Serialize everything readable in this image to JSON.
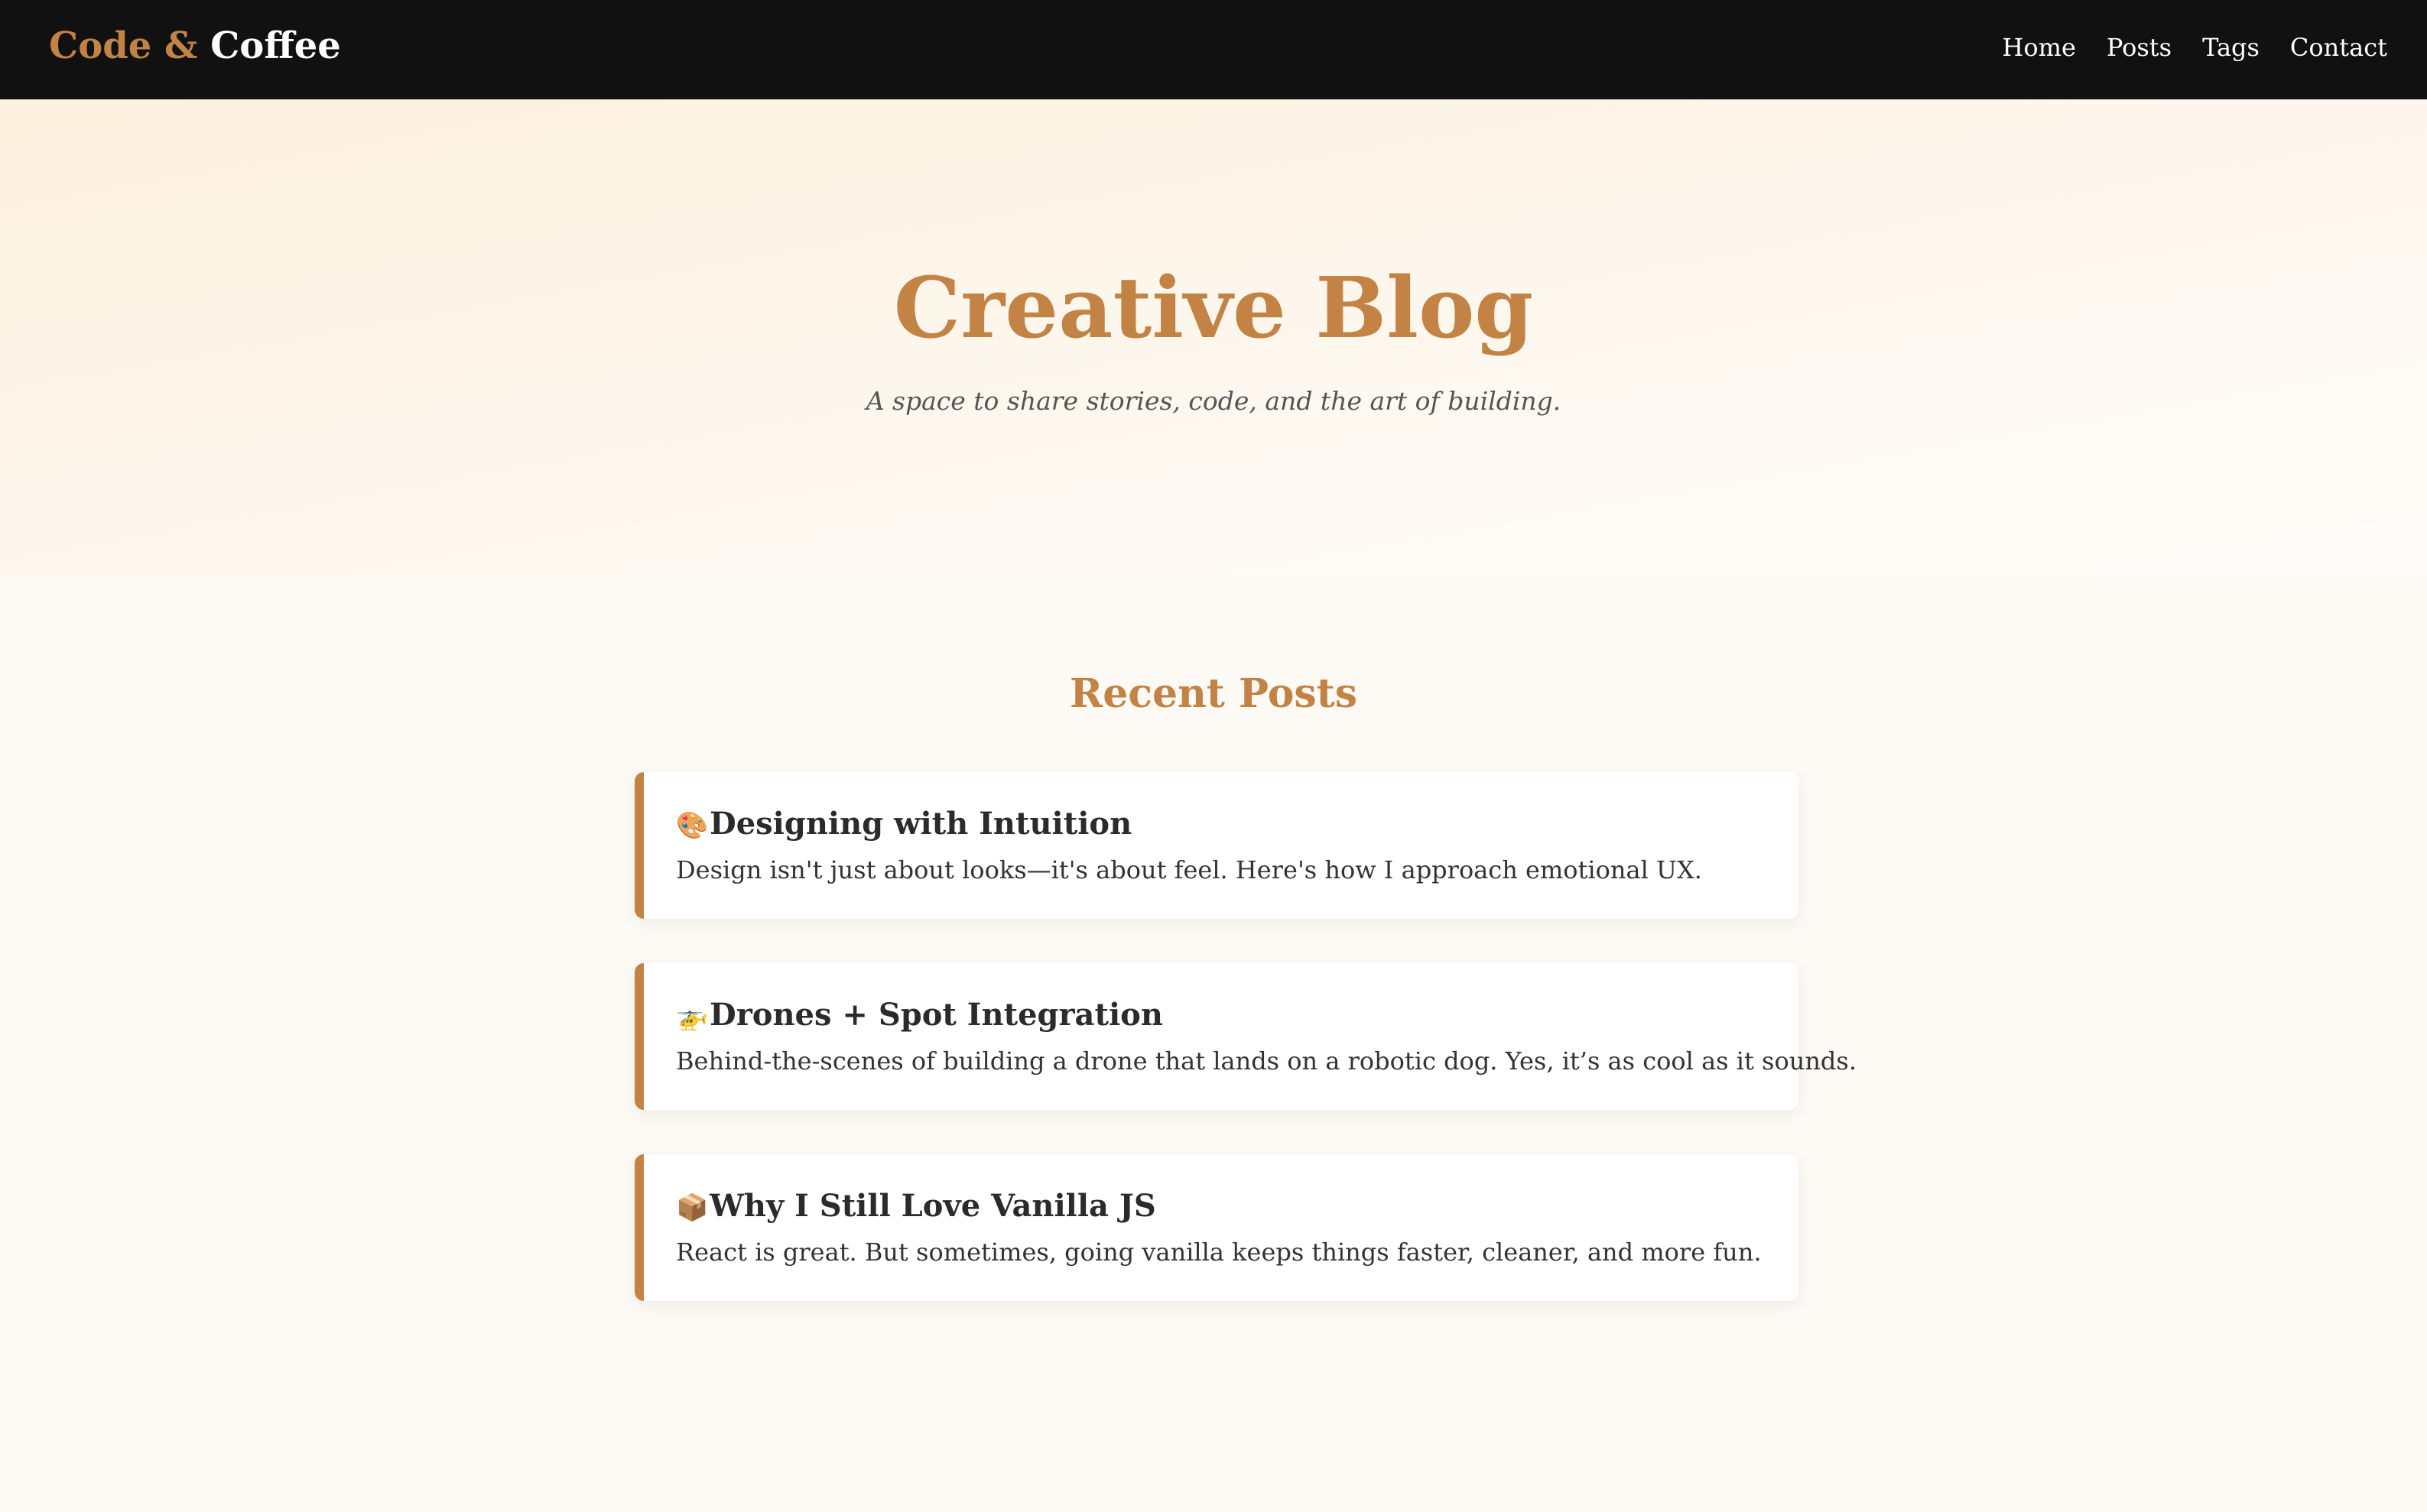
{
  "header": {
    "logo_part1": "Code &",
    "logo_part2": "Coffee",
    "nav": [
      {
        "label": "Home"
      },
      {
        "label": "Posts"
      },
      {
        "label": "Tags"
      },
      {
        "label": "Contact"
      }
    ]
  },
  "hero": {
    "title": "Creative Blog",
    "subtitle": "A space to share stories, code, and the art of building."
  },
  "recent": {
    "heading": "Recent Posts",
    "posts": [
      {
        "icon": "🎨",
        "icon_name": "palette-icon",
        "title": "Designing with Intuition",
        "excerpt": "Design isn't just about looks—it's about feel. Here's how I approach emotional UX."
      },
      {
        "icon": "🚁",
        "icon_name": "helicopter-icon",
        "title": "Drones + Spot Integration",
        "excerpt": "Behind-the-scenes of building a drone that lands on a robotic dog. Yes, it’s as cool as it sounds."
      },
      {
        "icon": "📦",
        "icon_name": "package-icon",
        "title": "Why I Still Love Vanilla JS",
        "excerpt": "React is great. But sometimes, going vanilla keeps things faster, cleaner, and more fun."
      }
    ]
  },
  "colors": {
    "accent": "#c38345",
    "nav_bg": "#111111",
    "page_bg": "#fdfaf6"
  }
}
